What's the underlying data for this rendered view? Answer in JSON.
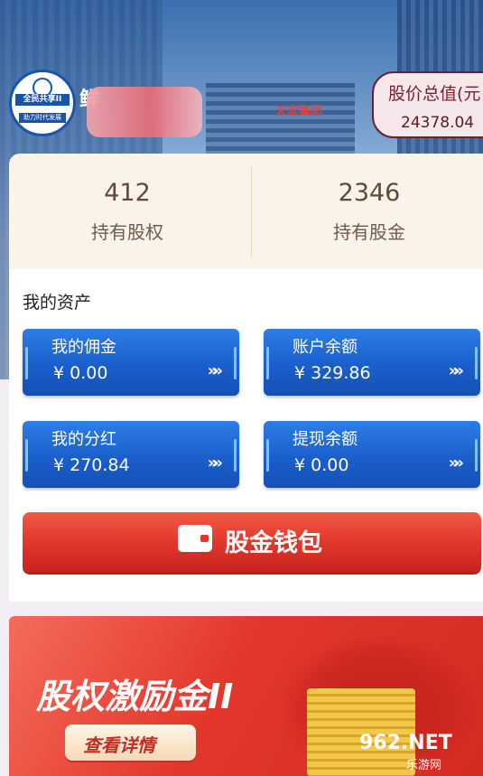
{
  "user": {
    "logo_top_text": "全民共享II",
    "logo_bottom_text": "助力时代发展",
    "name": "鲜"
  },
  "stock_total": {
    "label": "股价总值(元",
    "value": "24378.04"
  },
  "stats": [
    {
      "value": "412",
      "label": "持有股权"
    },
    {
      "value": "2346",
      "label": "持有股金"
    }
  ],
  "assets": {
    "title": "我的资产",
    "tiles": [
      {
        "label": "我的佣金",
        "value": "¥ 0.00"
      },
      {
        "label": "账户余额",
        "value": "¥ 329.86"
      },
      {
        "label": "我的分红",
        "value": "¥ 270.84"
      },
      {
        "label": "提现余额",
        "value": "¥ 0.00"
      }
    ],
    "arrow_glyph": "»»"
  },
  "wallet_button": {
    "label": "股金钱包",
    "icon": "wallet-icon"
  },
  "banner": {
    "title": "股权激励金II",
    "button_label": "查看详情"
  },
  "building_sign": "天宏集团",
  "watermark": {
    "main": "962.NET",
    "sub": "乐游网"
  },
  "colors": {
    "tile_blue": "#1a5fcc",
    "wallet_red": "#e2372c",
    "stock_border": "#6c1f2c"
  }
}
